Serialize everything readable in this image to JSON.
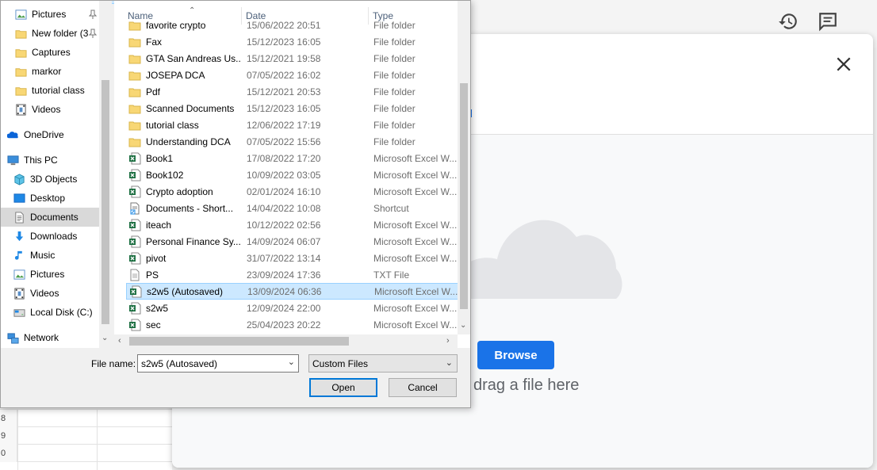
{
  "nav": {
    "items": [
      {
        "label": "Pictures",
        "icon": "pictures-icon",
        "pinned": true
      },
      {
        "label": "New folder (3",
        "icon": "folder-icon",
        "pinned": true
      },
      {
        "label": "Captures",
        "icon": "folder-icon"
      },
      {
        "label": "markor",
        "icon": "folder-icon"
      },
      {
        "label": "tutorial class",
        "icon": "folder-icon"
      },
      {
        "label": "Videos",
        "icon": "videos-icon"
      },
      {
        "label": "OneDrive",
        "icon": "onedrive-icon"
      },
      {
        "label": "This PC",
        "icon": "this-pc-icon"
      },
      {
        "label": "3D Objects",
        "icon": "3d-objects-icon"
      },
      {
        "label": "Desktop",
        "icon": "desktop-icon"
      },
      {
        "label": "Documents",
        "icon": "documents-icon",
        "selected": true
      },
      {
        "label": "Downloads",
        "icon": "downloads-icon"
      },
      {
        "label": "Music",
        "icon": "music-icon"
      },
      {
        "label": "Pictures",
        "icon": "pictures-icon"
      },
      {
        "label": "Videos",
        "icon": "videos-icon"
      },
      {
        "label": "Local Disk (C:)",
        "icon": "local-disk-icon"
      },
      {
        "label": "Network",
        "icon": "network-icon"
      }
    ]
  },
  "columns": {
    "name": "Name",
    "date": "Date",
    "type": "Type"
  },
  "files": [
    {
      "name": "favorite crypto",
      "date": "15/06/2022 20:51",
      "type": "File folder",
      "kind": "folder"
    },
    {
      "name": "Fax",
      "date": "15/12/2023 16:05",
      "type": "File folder",
      "kind": "folder"
    },
    {
      "name": "GTA San Andreas Us...",
      "date": "15/12/2021 19:58",
      "type": "File folder",
      "kind": "folder"
    },
    {
      "name": "JOSEPA DCA",
      "date": "07/05/2022 16:02",
      "type": "File folder",
      "kind": "folder"
    },
    {
      "name": "Pdf",
      "date": "15/12/2021 20:53",
      "type": "File folder",
      "kind": "folder"
    },
    {
      "name": "Scanned Documents",
      "date": "15/12/2023 16:05",
      "type": "File folder",
      "kind": "folder"
    },
    {
      "name": "tutorial class",
      "date": "12/06/2022 17:19",
      "type": "File folder",
      "kind": "folder"
    },
    {
      "name": "Understanding DCA",
      "date": "07/05/2022 15:56",
      "type": "File folder",
      "kind": "folder"
    },
    {
      "name": "Book1",
      "date": "17/08/2022 17:20",
      "type": "Microsoft Excel W...",
      "kind": "excel"
    },
    {
      "name": "Book102",
      "date": "10/09/2022 03:05",
      "type": "Microsoft Excel W...",
      "kind": "excel"
    },
    {
      "name": "Crypto adoption",
      "date": "02/01/2024 16:10",
      "type": "Microsoft Excel W...",
      "kind": "excel"
    },
    {
      "name": "Documents - Short...",
      "date": "14/04/2022 10:08",
      "type": "Shortcut",
      "kind": "shortcut"
    },
    {
      "name": "iteach",
      "date": "10/12/2022 02:56",
      "type": "Microsoft Excel W...",
      "kind": "excel"
    },
    {
      "name": "Personal Finance Sy...",
      "date": "14/09/2024 06:07",
      "type": "Microsoft Excel W...",
      "kind": "excel"
    },
    {
      "name": "pivot",
      "date": "31/07/2022 13:14",
      "type": "Microsoft Excel W...",
      "kind": "excel"
    },
    {
      "name": "PS",
      "date": "23/09/2024 17:36",
      "type": "TXT File",
      "kind": "txt"
    },
    {
      "name": "s2w5 (Autosaved)",
      "date": "13/09/2024 06:36",
      "type": "Microsoft Excel W...",
      "kind": "excel",
      "selected": true
    },
    {
      "name": "s2w5",
      "date": "12/09/2024 22:00",
      "type": "Microsoft Excel W...",
      "kind": "excel"
    },
    {
      "name": "sec",
      "date": "25/04/2023 20:22",
      "type": "Microsoft Excel W...",
      "kind": "excel"
    }
  ],
  "footer": {
    "filename_label": "File name:",
    "filename_value": "s2w5 (Autosaved)",
    "filetype_value": "Custom Files",
    "open_label": "Open",
    "cancel_label": "Cancel"
  },
  "upload": {
    "browse_label": "Browse",
    "drag_text": "drag a file here"
  },
  "sheet": {
    "row_numbers": [
      "8",
      "9",
      "0"
    ]
  },
  "colors": {
    "accent": "#1a73e8",
    "selection": "#cce8ff",
    "excel_green": "#1d6f42",
    "folder": "#f8d775"
  }
}
